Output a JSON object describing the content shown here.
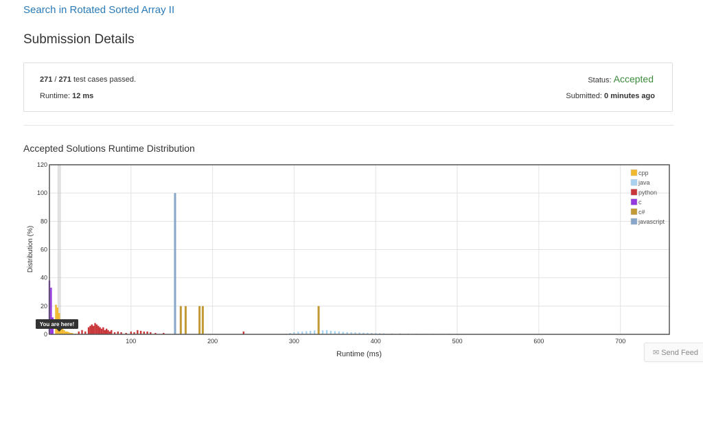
{
  "problem_link": "Search in Rotated Sorted Array II",
  "page_title": "Submission Details",
  "details": {
    "passed": "271",
    "sep": " / ",
    "total": "271",
    "passed_suffix": " test cases passed.",
    "runtime_label": "Runtime: ",
    "runtime_value": "12 ms",
    "status_label": "Status: ",
    "status_value": "Accepted",
    "submitted_label": "Submitted: ",
    "submitted_value": "0 minutes ago"
  },
  "section_title": "Accepted Solutions Runtime Distribution",
  "feedback": {
    "icon": "envelope-icon",
    "label": "Send Feed"
  },
  "chart_data": {
    "type": "bar",
    "title": "",
    "xlabel": "Runtime (ms)",
    "ylabel": "Distribution (%)",
    "xlim": [
      0,
      760
    ],
    "ylim": [
      0,
      120
    ],
    "xticks": [
      100,
      200,
      300,
      400,
      500,
      600,
      700
    ],
    "yticks": [
      0,
      20,
      40,
      60,
      80,
      100,
      120
    ],
    "grid": true,
    "legend": "top-right",
    "highlight": {
      "x": 12,
      "label": "You are here!"
    },
    "series": [
      {
        "name": "cpp",
        "color": "#f0b92e",
        "x": [
          8,
          10,
          12,
          14,
          16,
          18,
          20,
          22,
          24,
          26,
          28,
          32,
          36,
          40
        ],
        "values": [
          21,
          19,
          15,
          8,
          4,
          3,
          2,
          2,
          1.5,
          1,
          1,
          0.5,
          0.5,
          0.3
        ]
      },
      {
        "name": "java",
        "color": "#a9d1f0",
        "x": [
          290,
          295,
          300,
          305,
          310,
          315,
          320,
          325,
          330,
          335,
          340,
          345,
          350,
          355,
          360,
          365,
          370,
          375,
          380,
          385,
          390,
          395,
          400,
          405,
          410,
          420,
          430,
          440,
          450,
          460,
          470,
          480,
          490,
          500,
          510,
          530,
          550,
          570,
          600,
          650,
          700
        ],
        "values": [
          0.5,
          1,
          1.5,
          1.8,
          2,
          2.2,
          2.5,
          2.8,
          3,
          2.8,
          3,
          2.5,
          2.2,
          2,
          1.8,
          1.6,
          1.5,
          1.4,
          1.3,
          1.2,
          1.1,
          1,
          0.9,
          0.8,
          0.7,
          0.6,
          0.6,
          0.5,
          0.5,
          0.4,
          0.5,
          0.4,
          0.4,
          0.4,
          0.3,
          0.3,
          0.3,
          0.3,
          0.3,
          0.3,
          0.2
        ]
      },
      {
        "name": "python",
        "color": "#c9363a",
        "x": [
          36,
          40,
          44,
          48,
          50,
          52,
          54,
          56,
          58,
          60,
          62,
          64,
          66,
          68,
          70,
          72,
          74,
          76,
          80,
          84,
          88,
          94,
          100,
          104,
          108,
          112,
          116,
          120,
          124,
          130,
          140,
          238
        ],
        "values": [
          2,
          3,
          2,
          5,
          6,
          7,
          6,
          8,
          7,
          6,
          5,
          4,
          5,
          3,
          4,
          3,
          2,
          3,
          1.5,
          2,
          1.5,
          1,
          2,
          1.5,
          3,
          2.5,
          2,
          2,
          1.5,
          1,
          1,
          2
        ]
      },
      {
        "name": "c",
        "color": "#9438e0",
        "x": [
          0,
          2,
          4
        ],
        "values": [
          38,
          33,
          12
        ]
      },
      {
        "name": "c#",
        "color": "#c29a35",
        "x": [
          161,
          167,
          184,
          188,
          330
        ],
        "values": [
          20,
          20,
          20,
          20,
          20
        ]
      },
      {
        "name": "javascript",
        "color": "#86a7c9",
        "x": [
          154
        ],
        "values": [
          100
        ]
      }
    ]
  }
}
